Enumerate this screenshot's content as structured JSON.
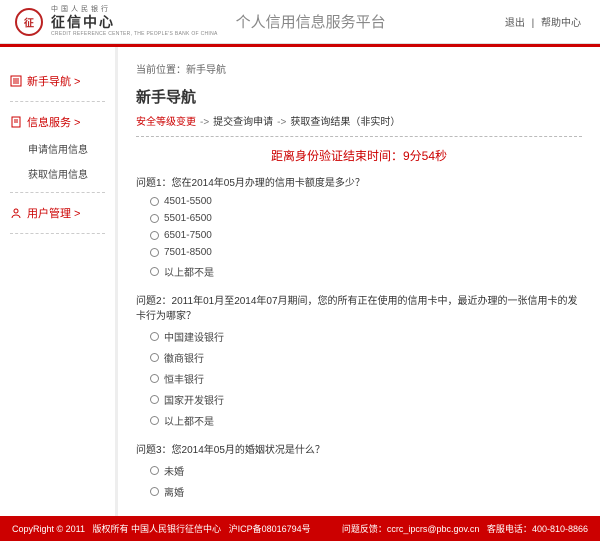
{
  "header": {
    "logo_top": "中国人民银行",
    "logo_cn": "征信中心",
    "logo_en": "CREDIT REFERENCE CENTER, THE PEOPLE'S BANK OF CHINA",
    "platform": "个人信用信息服务平台",
    "logout": "退出",
    "help": "帮助中心"
  },
  "sidebar": {
    "nav_guide": "新手导航 >",
    "info_service": "信息服务 >",
    "apply_info": "申请信用信息",
    "get_info": "获取信用信息",
    "user_mgmt": "用户管理 >"
  },
  "main": {
    "breadcrumb_label": "当前位置：",
    "breadcrumb_value": "新手导航",
    "title": "新手导航",
    "step1": "安全等级变更",
    "step2": "提交查询申请",
    "step3": "获取查询结果（非实时）",
    "countdown": "距离身份验证结束时间：9分54秒",
    "q1": "问题1：您在2014年05月办理的信用卡额度是多少？",
    "q1_opts": [
      "4501-5500",
      "5501-6500",
      "6501-7500",
      "7501-8500",
      "以上都不是"
    ],
    "q2": "问题2：2011年01月至2014年07月期间，您的所有正在使用的信用卡中，最近办理的一张信用卡的发卡行为哪家？",
    "q2_opts": [
      "中国建设银行",
      "徽商银行",
      "恒丰银行",
      "国家开发银行",
      "以上都不是"
    ],
    "q3": "问题3：您2014年05月的婚姻状况是什么？",
    "q3_opts": [
      "未婚",
      "离婚"
    ]
  },
  "footer": {
    "copyright": "CopyRight © 2011",
    "owner": "版权所有   中国人民银行征信中心",
    "icp": "沪ICP备08016794号",
    "feedback_label": "问题反馈：",
    "feedback_email": "ccrc_ipcrs@pbc.gov.cn",
    "tel_label": "客服电话：",
    "tel": "400-810-8866"
  }
}
